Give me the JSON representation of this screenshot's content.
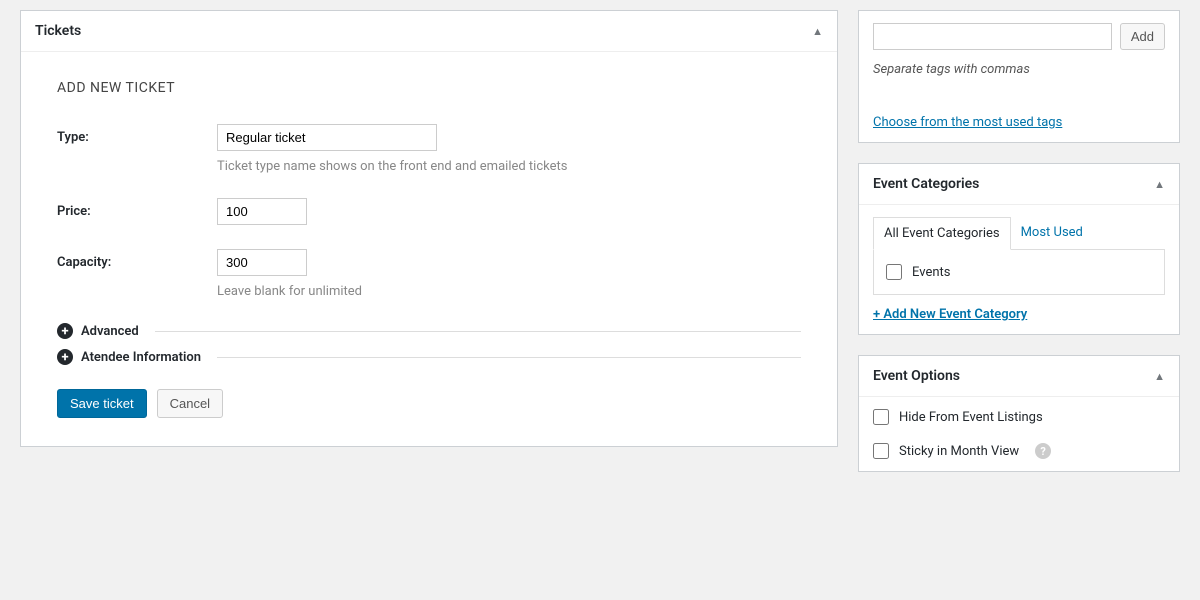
{
  "tickets": {
    "panel_title": "Tickets",
    "section_title": "ADD NEW TICKET",
    "type_label": "Type:",
    "type_value": "Regular ticket",
    "type_help": "Ticket type name shows on the front end and emailed tickets",
    "price_label": "Price:",
    "price_value": "100",
    "capacity_label": "Capacity:",
    "capacity_value": "300",
    "capacity_help": "Leave blank for unlimited",
    "advanced_label": "Advanced",
    "attendee_label": "Atendee Information",
    "save_label": "Save ticket",
    "cancel_label": "Cancel"
  },
  "tags": {
    "add_label": "Add",
    "help": "Separate tags with commas",
    "choose_link": "Choose from the most used tags"
  },
  "event_categories": {
    "panel_title": "Event Categories",
    "tab_all": "All Event Categories",
    "tab_most": "Most Used",
    "item_events": "Events",
    "add_link": "+ Add New Event Category"
  },
  "event_options": {
    "panel_title": "Event Options",
    "hide_label": "Hide From Event Listings",
    "sticky_label": "Sticky in Month View"
  }
}
